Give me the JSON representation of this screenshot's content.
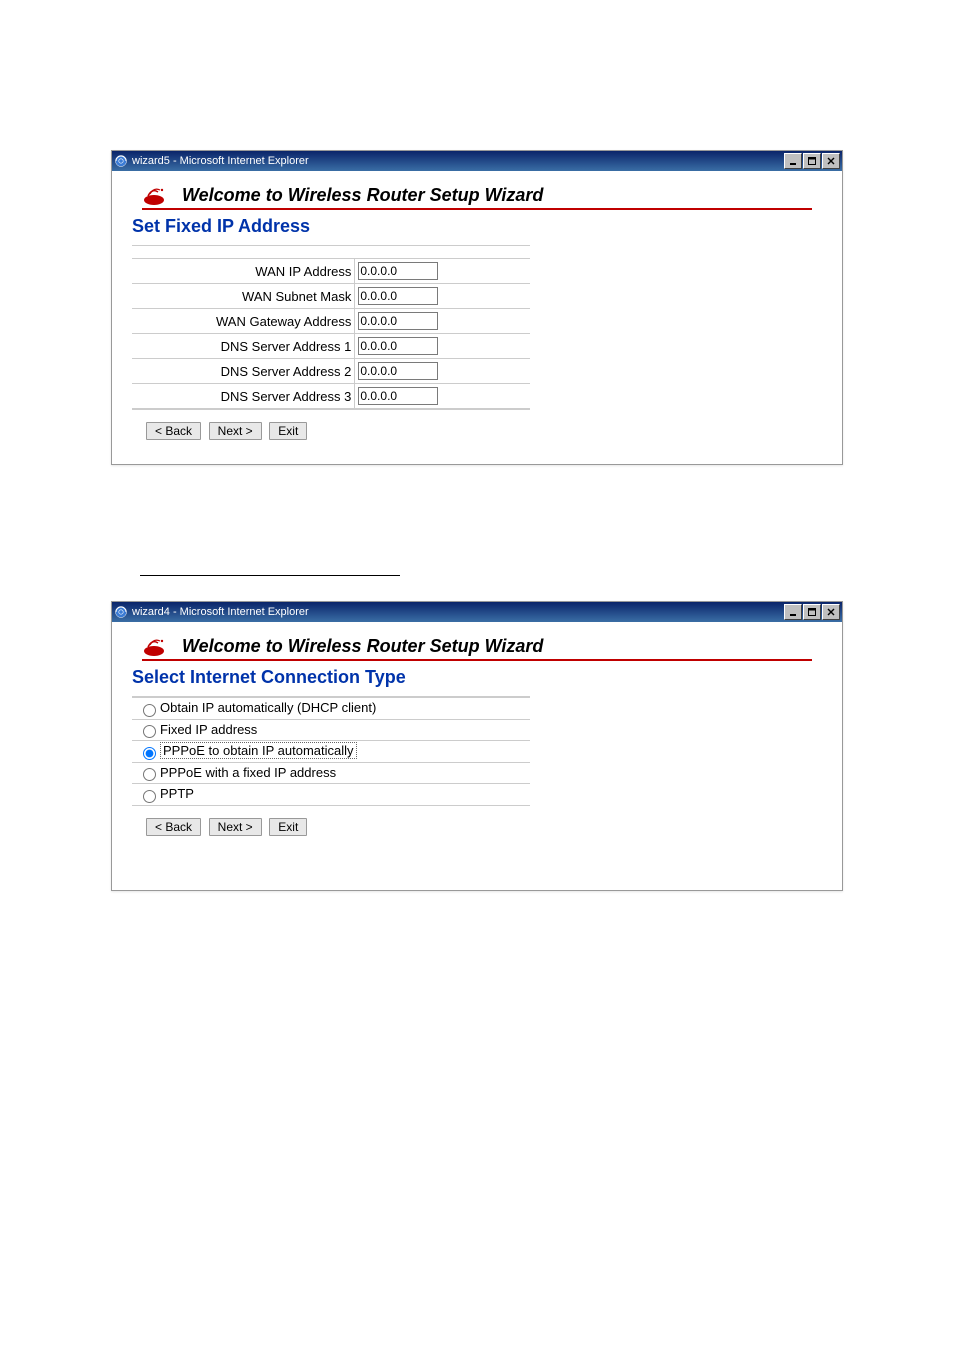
{
  "window1": {
    "title": "wizard5 - Microsoft Internet Explorer",
    "wizard_title": "Welcome to Wireless Router Setup Wizard",
    "section_title": "Set Fixed IP Address",
    "fields": [
      {
        "label": "WAN IP Address",
        "value": "0.0.0.0"
      },
      {
        "label": "WAN Subnet Mask",
        "value": "0.0.0.0"
      },
      {
        "label": "WAN Gateway Address",
        "value": "0.0.0.0"
      },
      {
        "label": "DNS Server Address 1",
        "value": "0.0.0.0"
      },
      {
        "label": "DNS Server Address 2",
        "value": "0.0.0.0"
      },
      {
        "label": "DNS Server Address 3",
        "value": "0.0.0.0"
      }
    ],
    "buttons": {
      "back": "< Back",
      "next": "Next >",
      "exit": "Exit"
    }
  },
  "window2": {
    "title": "wizard4 - Microsoft Internet Explorer",
    "wizard_title": "Welcome to Wireless Router Setup Wizard",
    "section_title": "Select Internet Connection Type",
    "options": [
      {
        "label": "Obtain IP automatically (DHCP client)",
        "selected": false
      },
      {
        "label": "Fixed IP address",
        "selected": false
      },
      {
        "label": "PPPoE to obtain IP automatically",
        "selected": true
      },
      {
        "label": "PPPoE with a fixed IP address",
        "selected": false
      },
      {
        "label": "PPTP",
        "selected": false
      }
    ],
    "buttons": {
      "back": "< Back",
      "next": "Next >",
      "exit": "Exit"
    }
  }
}
